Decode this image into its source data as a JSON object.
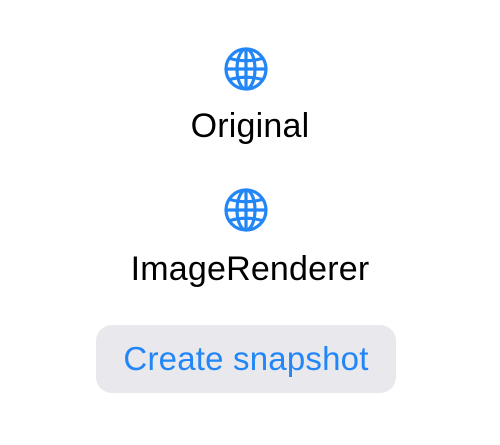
{
  "items": [
    {
      "icon": "globe-icon",
      "label": "Original"
    },
    {
      "icon": "globe-icon",
      "label": "ImageRenderer"
    }
  ],
  "button": {
    "label": "Create snapshot"
  },
  "colors": {
    "accent": "#2286f6",
    "button_bg": "#e8e8ed",
    "text": "#000000",
    "background": "#ffffff"
  }
}
